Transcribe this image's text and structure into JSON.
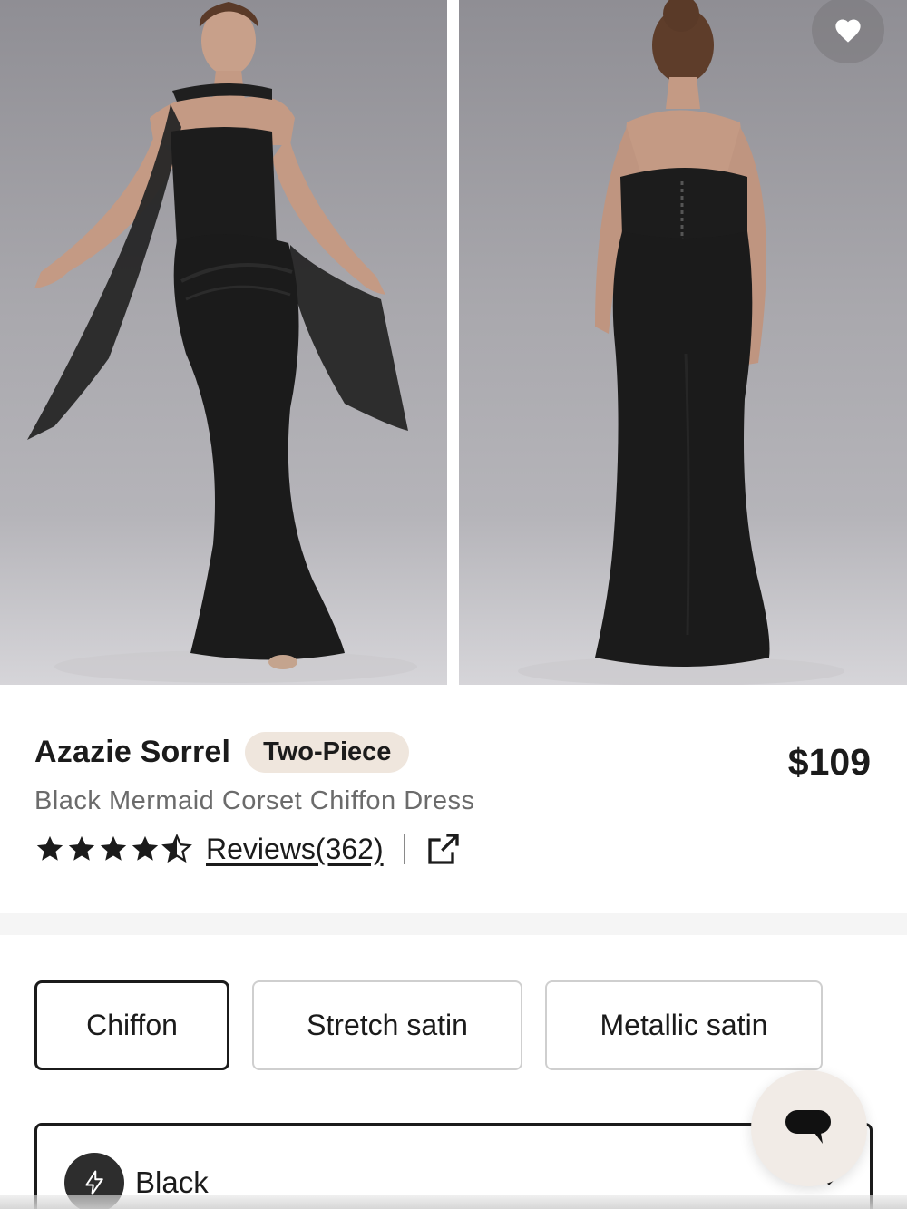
{
  "gallery": {
    "images": [
      {
        "alt": "front-view"
      },
      {
        "alt": "back-view"
      }
    ]
  },
  "product": {
    "name": "Azazie Sorrel",
    "badge": "Two-Piece",
    "price": "$109",
    "subtitle": "Black Mermaid Corset Chiffon Dress",
    "rating": 4.5,
    "rating_max": 5,
    "reviews_label": "Reviews(362)"
  },
  "fabric": {
    "options": [
      "Chiffon",
      "Stretch satin",
      "Metallic satin"
    ],
    "selected": "Chiffon"
  },
  "color": {
    "selected_label": "Black",
    "swatch_color": "#2d2d2d"
  },
  "icons": {
    "favorite": "heart-icon",
    "share": "external-link-icon",
    "chat": "chat-bubble-icon",
    "color_type": "lightning-icon",
    "dropdown": "chevron-down-icon"
  },
  "colors": {
    "badge_bg": "#efe6dd",
    "chat_bg": "#f1ebe6",
    "text": "#1b1b1b",
    "subtitle": "#6b6b6b"
  }
}
